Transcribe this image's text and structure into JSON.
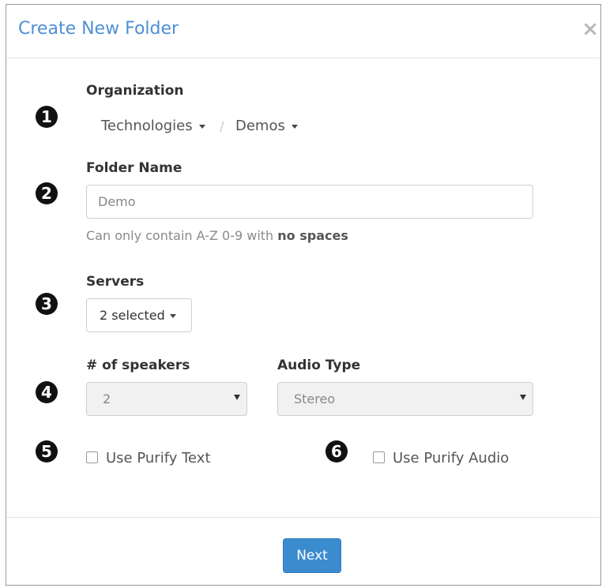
{
  "modal": {
    "title": "Create New Folder",
    "close_glyph": "×"
  },
  "steps": [
    "1",
    "2",
    "3",
    "4",
    "5",
    "6"
  ],
  "organization": {
    "label": "Organization",
    "breadcrumb": [
      "Technologies",
      "Demos"
    ],
    "separator": "/"
  },
  "folder_name": {
    "label": "Folder Name",
    "value": "Demo",
    "help_prefix": "Can only contain A-Z 0-9 with ",
    "help_emphasis": "no spaces"
  },
  "servers": {
    "label": "Servers",
    "selected_text": "2 selected"
  },
  "speakers": {
    "label": "# of speakers",
    "value": "2"
  },
  "audio_type": {
    "label": "Audio Type",
    "value": "Stereo"
  },
  "options": {
    "purify_text": "Use Purify Text",
    "purify_audio": "Use Purify Audio"
  },
  "footer": {
    "next_label": "Next"
  },
  "colors": {
    "title_blue": "#4f8fd6",
    "primary_button": "#3b8ccf"
  }
}
